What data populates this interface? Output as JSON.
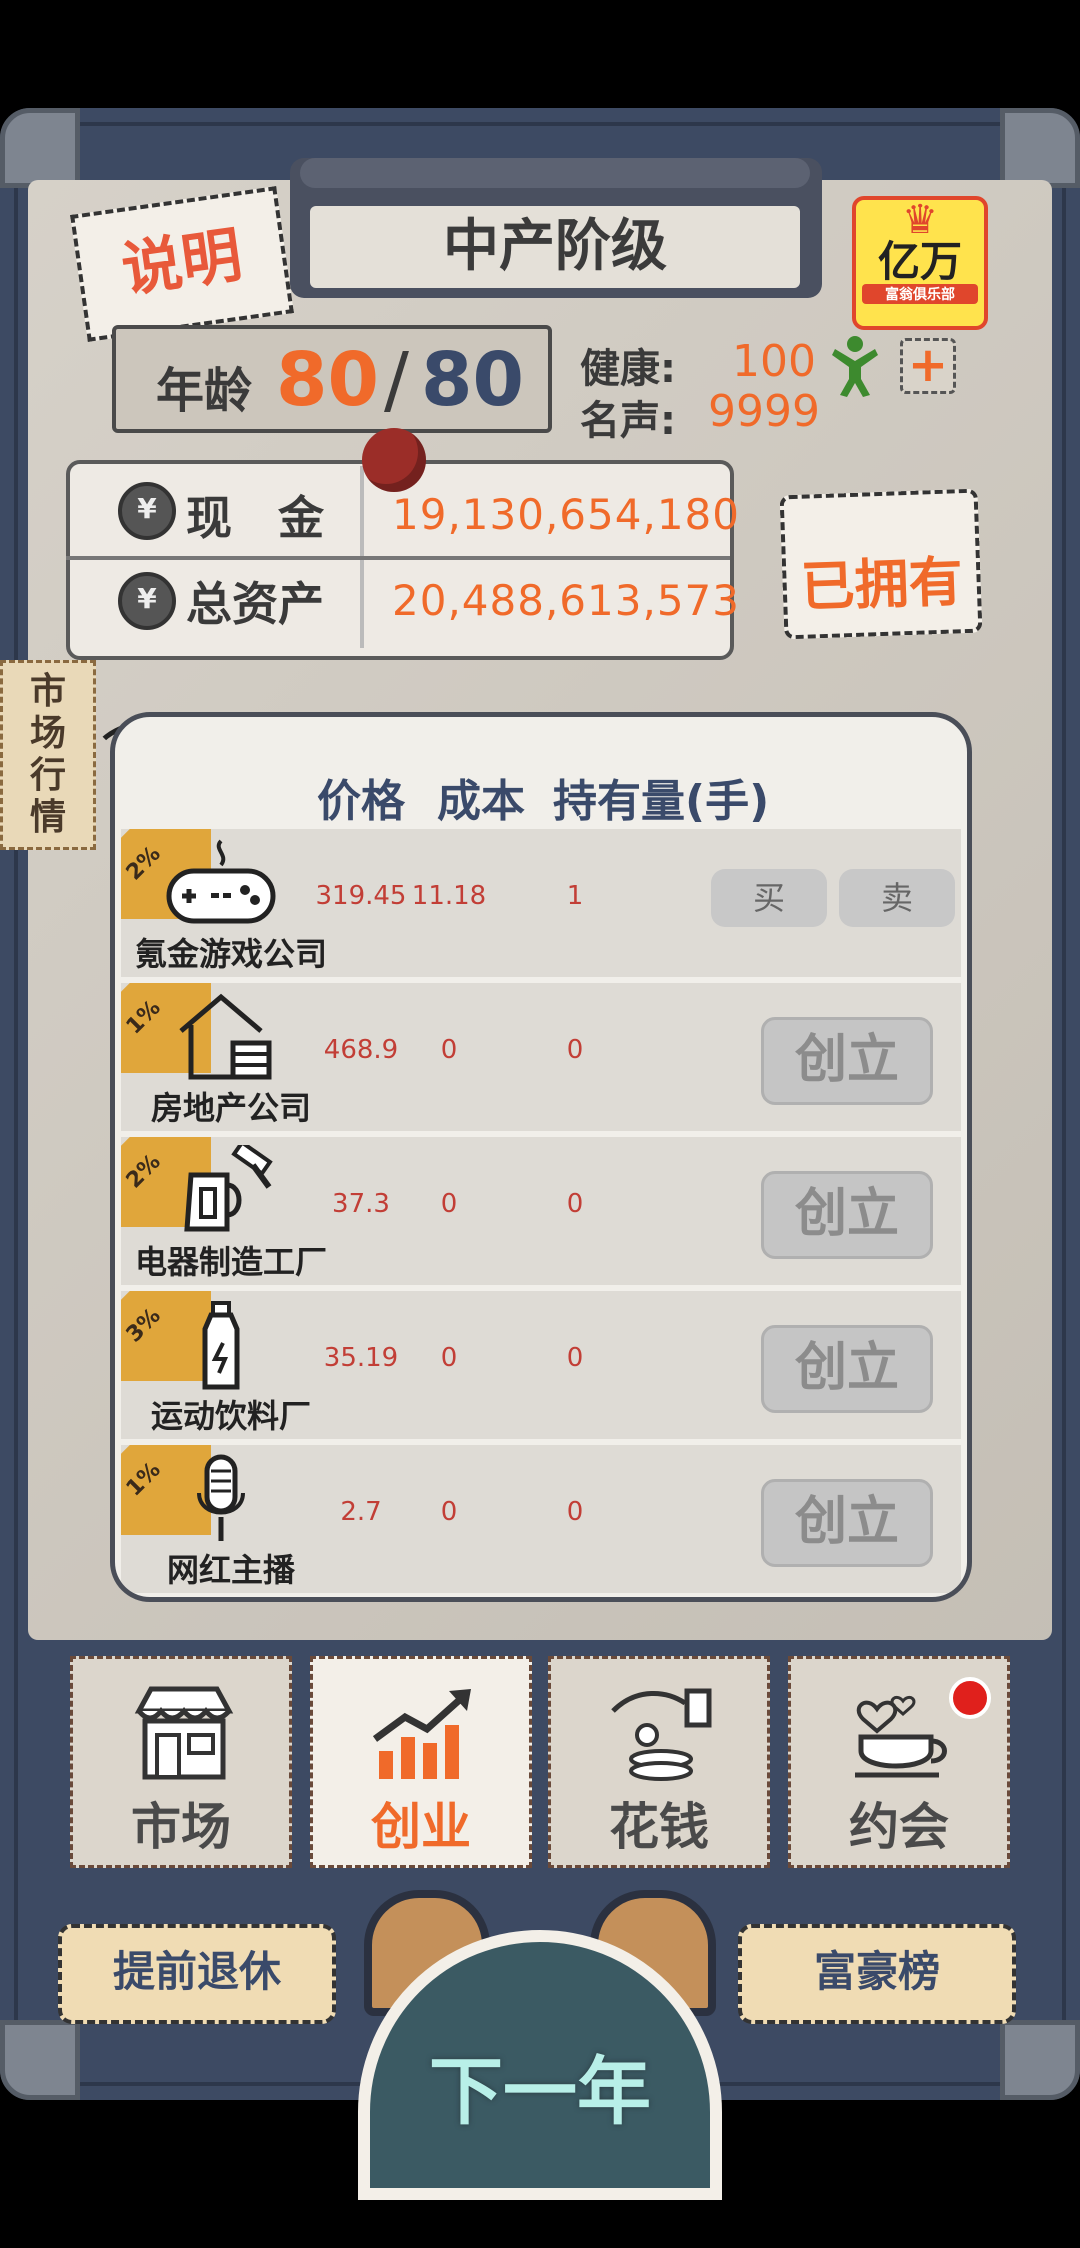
{
  "header": {
    "explain": "说明",
    "class_title": "中产阶级",
    "logo": {
      "line1": "亿万",
      "line2": "富翁俱乐部"
    }
  },
  "stats": {
    "age_label": "年龄",
    "age_current": "80",
    "age_slash": "/",
    "age_max": "80",
    "health_label": "健康:",
    "health_value": "100",
    "fame_label": "名声:",
    "fame_value": "9999",
    "plus": "+"
  },
  "money": {
    "cash_label": "现　金",
    "cash_value": "19,130,654,180",
    "assets_label": "总资产",
    "assets_value": "20,488,613,573",
    "owned_button": "已拥有"
  },
  "side_tag": [
    "市",
    "场",
    "行",
    "情"
  ],
  "market": {
    "headers": {
      "price": "价格",
      "cost": "成本",
      "holding": "持有量(手)"
    },
    "rows": [
      {
        "pct": "2%",
        "name": "氪金游戏公司",
        "price": "319.45",
        "cost": "11.18",
        "holding": "1",
        "buy": "买",
        "sell": "卖",
        "icon": "gamepad-icon"
      },
      {
        "pct": "1%",
        "name": "房地产公司",
        "price": "468.9",
        "cost": "0",
        "holding": "0",
        "found": "创立",
        "icon": "house-icon"
      },
      {
        "pct": "2%",
        "name": "电器制造工厂",
        "price": "37.3",
        "cost": "0",
        "holding": "0",
        "found": "创立",
        "icon": "kettle-hammer-icon"
      },
      {
        "pct": "3%",
        "name": "运动饮料厂",
        "price": "35.19",
        "cost": "0",
        "holding": "0",
        "found": "创立",
        "icon": "bottle-icon"
      },
      {
        "pct": "1%",
        "name": "网红主播",
        "price": "2.7",
        "cost": "0",
        "holding": "0",
        "found": "创立",
        "icon": "microphone-icon"
      }
    ]
  },
  "tabs": [
    {
      "label": "市场",
      "icon": "shop-icon"
    },
    {
      "label": "创业",
      "icon": "chart-up-icon",
      "active": true
    },
    {
      "label": "花钱",
      "icon": "coin-hand-icon"
    },
    {
      "label": "约会",
      "icon": "coffee-heart-icon"
    }
  ],
  "bottom": {
    "retire": "提前退休",
    "rich_list": "富豪榜",
    "next_year": "下一年"
  }
}
